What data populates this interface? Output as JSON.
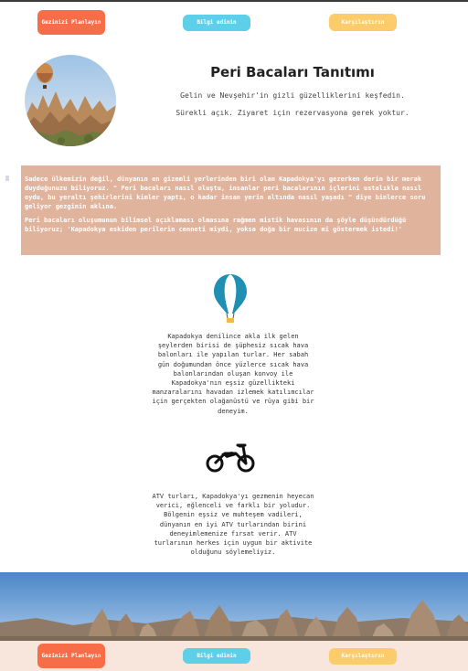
{
  "nav": {
    "plan_label": "Gezinizi Planlayın",
    "info_label": "Bilgi edinin",
    "compare_label": "Karşılaştırın"
  },
  "hero": {
    "title": "Peri Bacaları Tanıtımı",
    "subtitle_1": "Gelin ve Nevşehir'in gizli güzelliklerini keşfedin.",
    "subtitle_2": "Sürekli açık. Ziyaret için rezervasyona gerek yoktur."
  },
  "intro": {
    "paragraph_1": "Sadece ülkemizin değil, dünyanın en gizemli yerlerinden biri olan Kapadokya'yı gezerken derin bir merak duyduğunuzu biliyoruz. \" Peri bacaları nasıl oluştu, insanlar peri bacalarının içlerini ustalıkla nasıl oydu, bu yeraltı şehirlerini kimler yaptı, o kadar insan yerin altında nasıl yaşadı \" diye binlerce soru geliyor gezginin aklına.",
    "paragraph_2": "Peri bacaları oluşumunun bilimsel açıklaması olmasına rağmen mistik havasının da şöyle düşündürdüğü biliyoruz; 'Kapadokya eskiden perilerin cenneti miydi, yoksa doğa bir mucize mi göstermek istedi!'"
  },
  "features": {
    "balloon_icon": "hot-air-balloon-icon",
    "balloon_text": "Kapadokya denilince akla ilk gelen şeylerden birisi de şüphesiz sıcak hava balonları ile yapılan turlar. Her sabah gün doğumundan önce yüzlerce sıcak hava balonlarından oluşan konvoy ile Kapadokya'nın eşsiz güzellikteki manzaralarını havadan izlemek katılımcılar için gerçekten olağanüstü ve rüya gibi bir deneyim.",
    "atv_icon": "motorcycle-icon",
    "atv_text": "ATV turları, Kapadokya'yı gezmenin heyecan verici, eğlenceli ve farklı bir yoludur. Bölgenin eşsiz ve muhteşem vadileri, dünyanın en iyi ATV turlarından birini deneyimlemenize fırsat verir. ATV turlarının herkes için uygun bir aktivite olduğunu söylemeliyiz."
  },
  "colors": {
    "orange": "#f76d48",
    "blue": "#5dcfe8",
    "yellow": "#fbcc69",
    "intro_bg": "#e0b39d",
    "footer_bg": "#f8e5dc",
    "balloon_blue": "#1f8fb3"
  }
}
